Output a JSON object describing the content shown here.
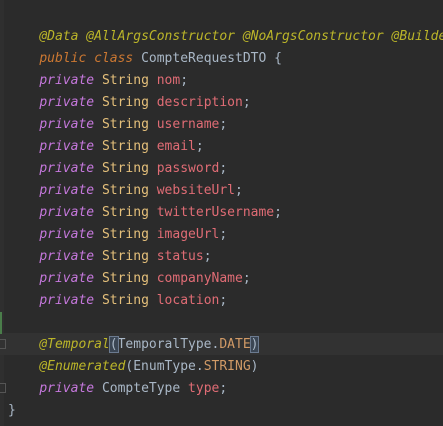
{
  "editor": {
    "line1": {
      "a1": "@Data",
      "a2": "@AllArgsConstructor",
      "a3": "@NoArgsConstructor",
      "a4": "@Builder"
    },
    "line2": {
      "kw_public": "public",
      "kw_class": "class",
      "class_name": "CompteRequestDTO",
      "brace": "{"
    },
    "fields": [
      {
        "mod": "private",
        "type": "String",
        "name": "nom"
      },
      {
        "mod": "private",
        "type": "String",
        "name": "description"
      },
      {
        "mod": "private",
        "type": "String",
        "name": "username"
      },
      {
        "mod": "private",
        "type": "String",
        "name": "email"
      },
      {
        "mod": "private",
        "type": "String",
        "name": "password"
      },
      {
        "mod": "private",
        "type": "String",
        "name": "websiteUrl"
      },
      {
        "mod": "private",
        "type": "String",
        "name": "twitterUsername"
      },
      {
        "mod": "private",
        "type": "String",
        "name": "imageUrl"
      },
      {
        "mod": "private",
        "type": "String",
        "name": "status"
      },
      {
        "mod": "private",
        "type": "String",
        "name": "companyName"
      },
      {
        "mod": "private",
        "type": "String",
        "name": "location"
      }
    ],
    "temporal": {
      "annotation": "@Temporal",
      "open": "(",
      "enum_type": "TemporalType",
      "dot": ".",
      "enum_value": "DATE",
      "close": ")"
    },
    "enumerated": {
      "annotation": "@Enumerated",
      "open": "(",
      "enum_type": "EnumType",
      "dot": ".",
      "enum_value": "STRING",
      "close": ")"
    },
    "last_field": {
      "mod": "private",
      "type": "CompteType",
      "name": "type"
    },
    "closing_brace": "}",
    "semicolon": ";"
  }
}
